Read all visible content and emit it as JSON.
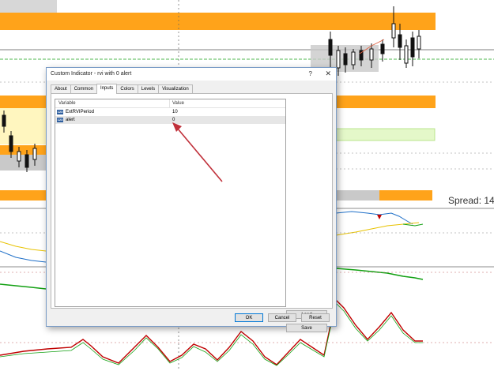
{
  "chart": {
    "spread_text": "Spread: 14",
    "colors": {
      "orange_band": "#ffa31a",
      "light_yellow": "#fff6bf",
      "light_green": "#e4f8c9",
      "green_line": "#12a012",
      "red_line": "#c00000",
      "blue_line": "#1e6fc8",
      "yellow_line": "#e8c200"
    }
  },
  "dialog": {
    "title": "Custom Indicator - rvi with 0 alert",
    "help_label": "?",
    "close_label": "✕",
    "tabs": [
      {
        "label": "About"
      },
      {
        "label": "Common"
      },
      {
        "label": "Inputs"
      },
      {
        "label": "Colors"
      },
      {
        "label": "Levels"
      },
      {
        "label": "Visualization"
      }
    ],
    "active_tab": "Inputs",
    "grid": {
      "headers": {
        "variable": "Variable",
        "value": "Value"
      },
      "rows": [
        {
          "icon": "int-icon",
          "name": "ExtRVIPeriod",
          "value": "10"
        },
        {
          "icon": "int-icon",
          "name": "alert",
          "value": "0"
        }
      ]
    },
    "buttons": {
      "load": "Load",
      "save": "Save",
      "ok": "OK",
      "cancel": "Cancel",
      "reset": "Reset"
    }
  },
  "annotation": {
    "arrow_color": "#c0303a"
  }
}
